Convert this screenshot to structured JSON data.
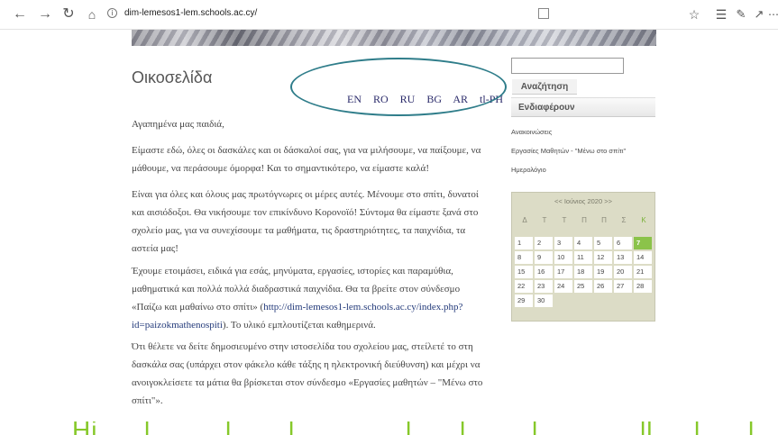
{
  "browser": {
    "url": "dim-lemesos1-lem.schools.ac.cy/",
    "icons": [
      "back-icon",
      "forward-icon",
      "reload-icon",
      "home-icon",
      "info-icon",
      "reader-view-icon",
      "favorite-star-icon",
      "favorites-list-icon",
      "pen-icon",
      "share-icon",
      "more-icon"
    ]
  },
  "page": {
    "title": "Οικοσελίδα",
    "languages": [
      "EN",
      "RO",
      "RU",
      "BG",
      "AR",
      "tl-PH"
    ],
    "paragraphs": {
      "p1": "Αγαπημένα μας παιδιά,",
      "p2": "Είμαστε εδώ,  όλες οι δασκάλες και οι δάσκαλοί σας, για να μιλήσουμε, να παίξουμε, να μάθουμε, να περάσουμε όμορφα! Και το σημαντικότερο, να είμαστε καλά!",
      "p3": "Είναι για όλες και όλους μας πρωτόγνωρες οι μέρες αυτές.  Μένουμε στο σπίτι,  δυνατοί και αισιόδοξοι.  Θα νικήσουμε τον επικίνδυνο Κορονοϊό!  Σύντομα θα είμαστε ξανά στο σχολείο μας, για να συνεχίσουμε τα μαθήματα, τις δραστηριότητες, τα παιχνίδια, τα αστεία μας!",
      "p4_before": "Έχουμε ετοιμάσει, ειδικά για εσάς, μηνύματα, εργασίες, ιστορίες και παραμύθια, μαθηματικά και πολλά πολλά διαδραστικά παιχνίδια.  Θα τα βρείτε στον σύνδεσμο «Παίζω και μαθαίνω στο σπίτι» (",
      "p4_link": "http://dim-lemesos1-lem.schools.ac.cy/index.php?id=paizokmathenospiti",
      "p4_after": "). Το υλικό εμπλουτίζεται καθημερινά.",
      "p5": "Ότι θέλετε να δείτε δημοσιευμένο στην ιστοσελίδα του σχολείου μας, στείλετέ το στη δασκάλα σας (υπάρχει στον φάκελο κάθε τάξης η ηλεκτρονική διεύθυνση) και μέχρι να ανοιγοκλείσετε τα μάτια θα βρίσκεται στον σύνδεσμο «Εργασίες μαθητών – \"Μένω στο σπίτι\"»."
    }
  },
  "sidebar": {
    "search_button": "Αναζήτηση",
    "section_heading": "Ενδιαφέρουν",
    "links": [
      "Ανακοινώσεις",
      "Εργασίες Μαθητών - \"Μένω στο σπίτι\"",
      "Ημερολόγιο"
    ]
  },
  "calendar": {
    "header": "<< Ιούνιος 2020 >>",
    "weekdays": [
      "Δ",
      "Τ",
      "Τ",
      "Π",
      "Π",
      "Σ",
      "Κ"
    ],
    "weeks": [
      [
        "1",
        "2",
        "3",
        "4",
        "5",
        "6",
        "7"
      ],
      [
        "8",
        "9",
        "10",
        "11",
        "12",
        "13",
        "14"
      ],
      [
        "15",
        "16",
        "17",
        "18",
        "19",
        "20",
        "21"
      ],
      [
        "22",
        "23",
        "24",
        "25",
        "26",
        "27",
        "28"
      ],
      [
        "29",
        "30",
        "",
        "",
        "",
        "",
        ""
      ]
    ],
    "today": "7",
    "today_color": "#8bc34a"
  },
  "colors": {
    "annotation_ellipse": "#2f7d8a",
    "bottom_text": "#86c82a",
    "link": "#233a7a"
  }
}
